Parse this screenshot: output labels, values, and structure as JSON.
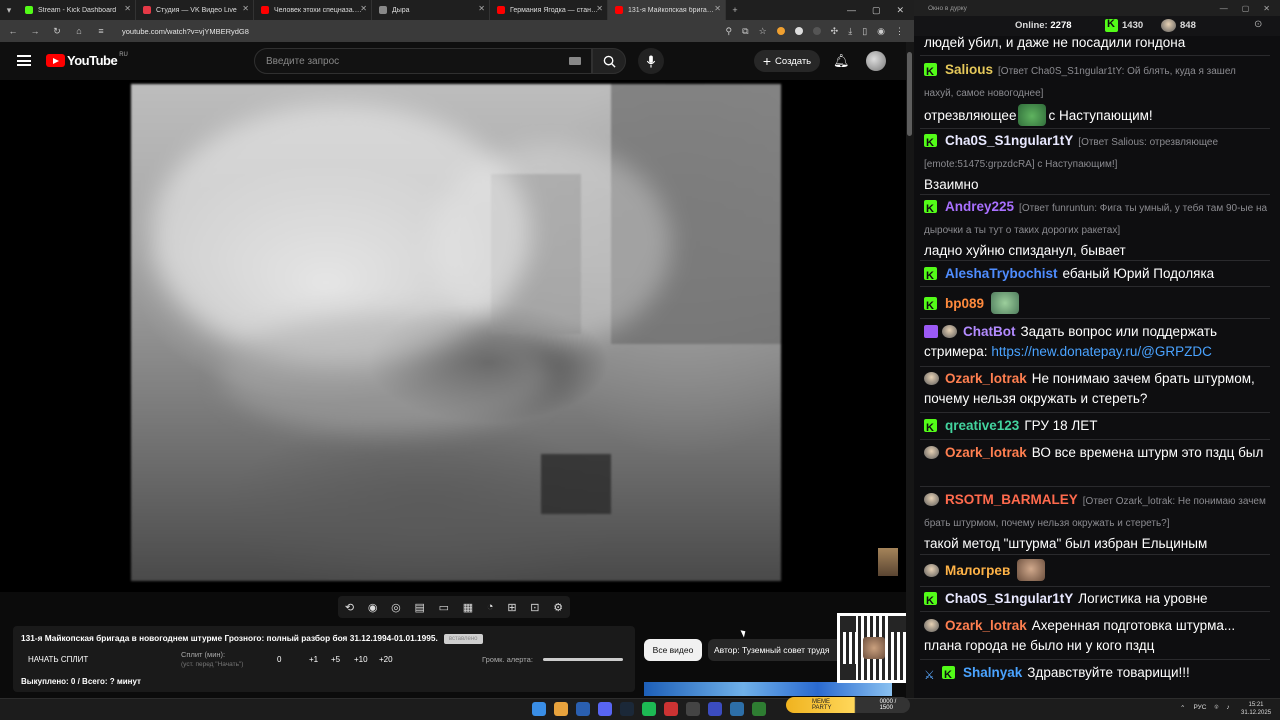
{
  "browser": {
    "tabs": [
      {
        "label": "Stream - Kick Dashboard",
        "color": "#53fc18",
        "active": false
      },
      {
        "label": "Студия — VK Видео Live",
        "color": "#e63946",
        "active": false
      },
      {
        "label": "Человек этохи спецназа. Как...",
        "color": "#ff0000",
        "active": false
      },
      {
        "label": "Дыра",
        "color": "#888888",
        "active": false
      },
      {
        "label": "Германия Ягодка — становлени...",
        "color": "#ff0000",
        "active": false
      },
      {
        "label": "131-я Майкопская бригад...",
        "color": "#ff0000",
        "active": true
      }
    ],
    "new_tab": "+",
    "url": "youtube.com/watch?v=vjYMBERydG8"
  },
  "youtube": {
    "logo_word": "YouTube",
    "region": "RU",
    "search_placeholder": "Введите запрос",
    "create_label": "Создать"
  },
  "split_widget": {
    "title": "131-я Майкопская бригада в новогоднем штурме Грозного: полный разбор боя 31.12.1994-01.01.1995.",
    "tag": "вставлено",
    "start_label": "НАЧАТЬ СПЛИТ",
    "split_label": "Сплит (мин):",
    "split_hint": "(уст. перед \"Начать\")",
    "buttons": [
      "0",
      "+1",
      "+5",
      "+10",
      "+20"
    ],
    "alert_label": "Громк. алерта:",
    "done_text": "Выкуплено: 0 / Всего: ? минут"
  },
  "chips": {
    "all_videos": "Все видео",
    "author": "Автор: Туземный совет трудя"
  },
  "chat": {
    "window_title": "Окно в дурку",
    "online_label": "Online:",
    "online_value": "2278",
    "kick_count": "1430",
    "twitch_count": "848",
    "messages": [
      {
        "badge": "",
        "nick": "",
        "nick_color": "#ffffff",
        "reply": "",
        "text": "людей убил, и даже не посадили гондона"
      },
      {
        "badge": "kick",
        "nick": "Salious",
        "nick_color": "#e5c85a",
        "reply": "[Ответ Cha0S_S1ngular1tY: Ой блять, куда я зашел нахуй, самое новогоднее]",
        "text": "отрезвляющее",
        "emote": "pepe",
        "text_after": "с Наступающим!"
      },
      {
        "badge": "kick",
        "nick": "Cha0S_S1ngular1tY",
        "nick_color": "#e8e8ff",
        "reply": "[Ответ Salious: отрезвляющее [emote:51475:grpzdcRA] с Наступающим!]",
        "text": "Взаимно"
      },
      {
        "badge": "kick",
        "nick": "Andrey225",
        "nick_color": "#a970ff",
        "reply": "[Ответ funruntun: Фига ты умный, у тебя там 90-ые на дырочки а ты тут о таких дорогих ракетах]",
        "text": "ладно хуйню спизданул, бывает"
      },
      {
        "badge": "kick",
        "nick": "AleshaTrybochist",
        "nick_color": "#4f8dff",
        "reply": "",
        "text": "ебаный Юрий Подоляка"
      },
      {
        "badge": "kick",
        "nick": "bp089",
        "nick_color": "#ff8a3d",
        "reply": "",
        "text": "",
        "emote": "frog2"
      },
      {
        "badge": "bot",
        "nick": "ChatBot",
        "nick_color": "#b38bff",
        "reply": "",
        "text": "Задать вопрос или поддержать стримера:",
        "link": "https://new.donatepay.ru/@GRPZDC"
      },
      {
        "badge": "twitch",
        "nick": "Ozark_lotrak",
        "nick_color": "#ff7f50",
        "reply": "",
        "text": "Не понимаю зачем брать штурмом, почему нельзя окружать и стереть?"
      },
      {
        "badge": "kick",
        "nick": "qreative123",
        "nick_color": "#43d39e",
        "reply": "",
        "text": "ГРУ 18 ЛЕТ"
      },
      {
        "badge": "twitch",
        "nick": "Ozark_lotrak",
        "nick_color": "#ff7f50",
        "reply": "",
        "text": "ВО все времена штурм это пздц был"
      },
      {
        "badge": "twitch",
        "nick": "RSOTM_BARMALEY",
        "nick_color": "#ff6a4d",
        "reply": "[Ответ Ozark_lotrak: Не понимаю зачем брать штурмом, почему нельзя окружать и стереть?]",
        "text": "такой метод \"штурма\" был избран Ельциным"
      },
      {
        "badge": "twitch",
        "nick": "Малогрев",
        "nick_color": "#ffb347",
        "reply": "",
        "text": "",
        "emote": "face"
      },
      {
        "badge": "kick",
        "nick": "Cha0S_S1ngular1tY",
        "nick_color": "#e8e8ff",
        "reply": "",
        "text": "Логистика на уровне"
      },
      {
        "badge": "twitch",
        "nick": "Ozark_lotrak",
        "nick_color": "#ff7f50",
        "reply": "",
        "text": "Ахеренная подготовка штурма... плана города не было ни у кого пздц"
      },
      {
        "badge": "kick",
        "nick": "Shalnyak",
        "nick_color": "#4aa3ff",
        "reply": "",
        "text": "Здравствуйте товарищи!!!"
      }
    ]
  },
  "taskbar": {
    "overlay_label": "MEME PARTY",
    "overlay_count": "0000 / 1500",
    "lang": "РУС",
    "time": "15:21",
    "date": "31.12.2025"
  }
}
